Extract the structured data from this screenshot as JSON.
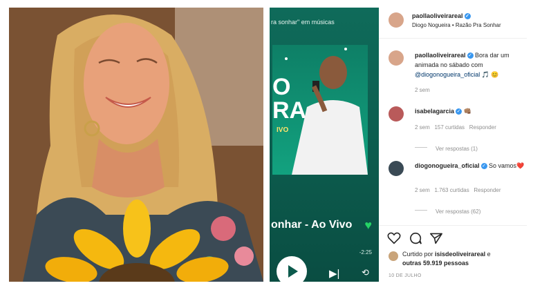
{
  "story": {
    "top_text": "ra sonhar\" em músicas",
    "cover_line1": "O",
    "cover_line2": "RA",
    "cover_vivo": "IVO",
    "song_title": "onhar - Ao Vivo",
    "time_remaining": "-2:25"
  },
  "header": {
    "username": "paollaoliveirareal",
    "subtitle": "Diogo Nogueira • Razão Pra Sonhar"
  },
  "caption": {
    "username": "paollaoliveirareal",
    "text": " Bora dar um animada no sábado com ",
    "mention": "@diogonogueira_oficial",
    "emoji": "🎵 😊",
    "time": "2 sem"
  },
  "comments": [
    {
      "username": "isabelagarcia",
      "text": "👊🏽",
      "time": "2 sem",
      "likes": "157 curtidas",
      "reply": "Responder",
      "view_replies": "Ver respostas (1)"
    },
    {
      "username": "diogonogueira_oficial",
      "text": "So vamos",
      "heart": "❤️",
      "time": "2 sem",
      "likes": "1.763 curtidas",
      "reply": "Responder",
      "view_replies": "Ver respostas (62)"
    }
  ],
  "footer": {
    "liked_prefix": "Curtido por ",
    "liked_user": "isisdeoliveirareal",
    "liked_suffix": " e",
    "liked_others": "outras 59.919 pessoas",
    "date": "10 DE JULHO"
  },
  "colors": {
    "verified": "#3897f0",
    "story_bg": "#0c5a4c",
    "green_heart": "#25d366"
  }
}
